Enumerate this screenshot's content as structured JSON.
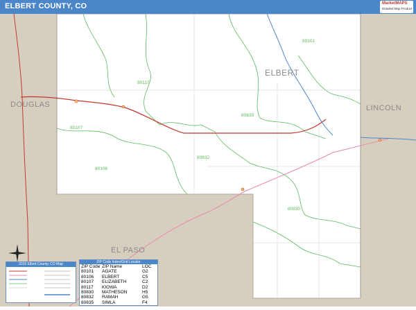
{
  "title": "ELBERT COUNTY, CO",
  "logo": {
    "name": "MarketMAPS",
    "subtitle": "Detailed Map Product"
  },
  "map": {
    "county_labels": {
      "elbert": "ELBERT",
      "douglas": "DOUGLAS",
      "lincoln": "LINCOLN",
      "el_paso": "EL PASO"
    },
    "zip_labels": {
      "z80101": "80101",
      "z80117": "80117",
      "z80835": "80835",
      "z80107": "80107",
      "z80832": "80832",
      "z80106": "80106",
      "z80830": "80830"
    },
    "colors": {
      "outside": "#d6cfc0",
      "inside": "#ffffff",
      "zip_boundary": "#5cb85c",
      "highway": "#c0392b",
      "road_pink": "#e88aa8",
      "water": "#4a86c8"
    }
  },
  "legend": {
    "title": "2016 Elbert County, CO Map"
  },
  "zip_index": {
    "title": "ZIP Code Index/Grid Locator",
    "headers": [
      "ZIP Code",
      "ZIP Name",
      "LOC"
    ],
    "rows": [
      [
        "80101",
        "AGATE",
        "G2"
      ],
      [
        "80106",
        "ELBERT",
        "C5"
      ],
      [
        "80107",
        "ELIZABETH",
        "C2"
      ],
      [
        "80117",
        "KIOWA",
        "D2"
      ],
      [
        "80830",
        "MATHESON",
        "H5"
      ],
      [
        "80832",
        "RAMAH",
        "G5"
      ],
      [
        "80835",
        "SIMLA",
        "F4"
      ]
    ]
  }
}
